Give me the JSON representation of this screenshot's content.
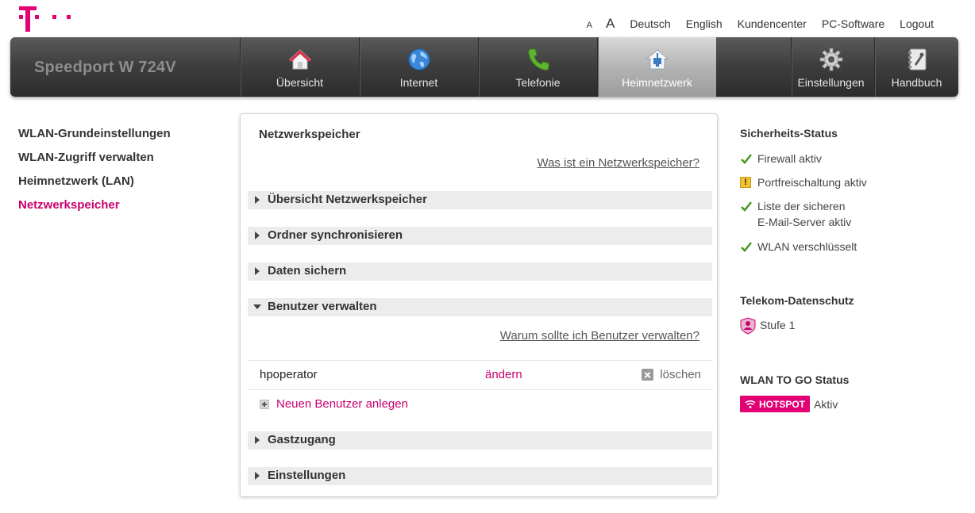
{
  "brand": {
    "logo_text": "T · · ·",
    "device_name": "Speedport W 724V",
    "colors": {
      "magenta": "#e20074",
      "link_magenta": "#c8006e"
    }
  },
  "toplinks": {
    "font_small": "A",
    "font_large": "A",
    "german": "Deutsch",
    "english": "English",
    "customer": "Kundencenter",
    "pc_software": "PC-Software",
    "logout": "Logout"
  },
  "nav": {
    "tabs": [
      {
        "label": "Übersicht",
        "icon": "home-icon"
      },
      {
        "label": "Internet",
        "icon": "globe-icon"
      },
      {
        "label": "Telefonie",
        "icon": "phone-icon"
      },
      {
        "label": "Heimnetzwerk",
        "icon": "network-icon",
        "active": true
      },
      {
        "label": "Einstellungen",
        "icon": "gear-icon"
      },
      {
        "label": "Handbuch",
        "icon": "book-icon"
      }
    ]
  },
  "sidebar": {
    "items": [
      {
        "label": "WLAN-Grundeinstellungen"
      },
      {
        "label": "WLAN-Zugriff verwalten"
      },
      {
        "label": "Heimnetzwerk (LAN)"
      },
      {
        "label": "Netzwerkspeicher",
        "active": true
      }
    ]
  },
  "main": {
    "title": "Netzwerkspeicher",
    "help_link": "Was ist ein Netzwerkspeicher?",
    "sections": [
      {
        "title": "Übersicht Netzwerkspeicher",
        "expanded": false
      },
      {
        "title": "Ordner synchronisieren",
        "expanded": false
      },
      {
        "title": "Daten sichern",
        "expanded": false
      },
      {
        "title": "Benutzer verwalten",
        "expanded": true
      },
      {
        "title": "Gastzugang",
        "expanded": false
      },
      {
        "title": "Einstellungen",
        "expanded": false
      }
    ],
    "users_help_link": "Warum sollte ich Benutzer verwalten?",
    "users": [
      {
        "name": "hpoperator",
        "edit": "ändern",
        "delete": "löschen"
      }
    ],
    "add_user": "Neuen Benutzer anlegen"
  },
  "status": {
    "security_title": "Sicherheits-Status",
    "security_items": [
      {
        "text": "Firewall aktiv",
        "icon": "check-icon"
      },
      {
        "text": "Portfreischaltung aktiv",
        "icon": "warning-icon"
      },
      {
        "text_line1": "Liste der sicheren",
        "text_line2": "E-Mail-Server aktiv",
        "icon": "check-icon"
      },
      {
        "text": "WLAN verschlüsselt",
        "icon": "check-icon"
      }
    ],
    "privacy_title": "Telekom-Datenschutz",
    "privacy_level": "Stufe 1",
    "wlan_to_go_title": "WLAN TO GO Status",
    "hotspot_badge": "HOTSPOT",
    "hotspot_state": "Aktiv"
  }
}
